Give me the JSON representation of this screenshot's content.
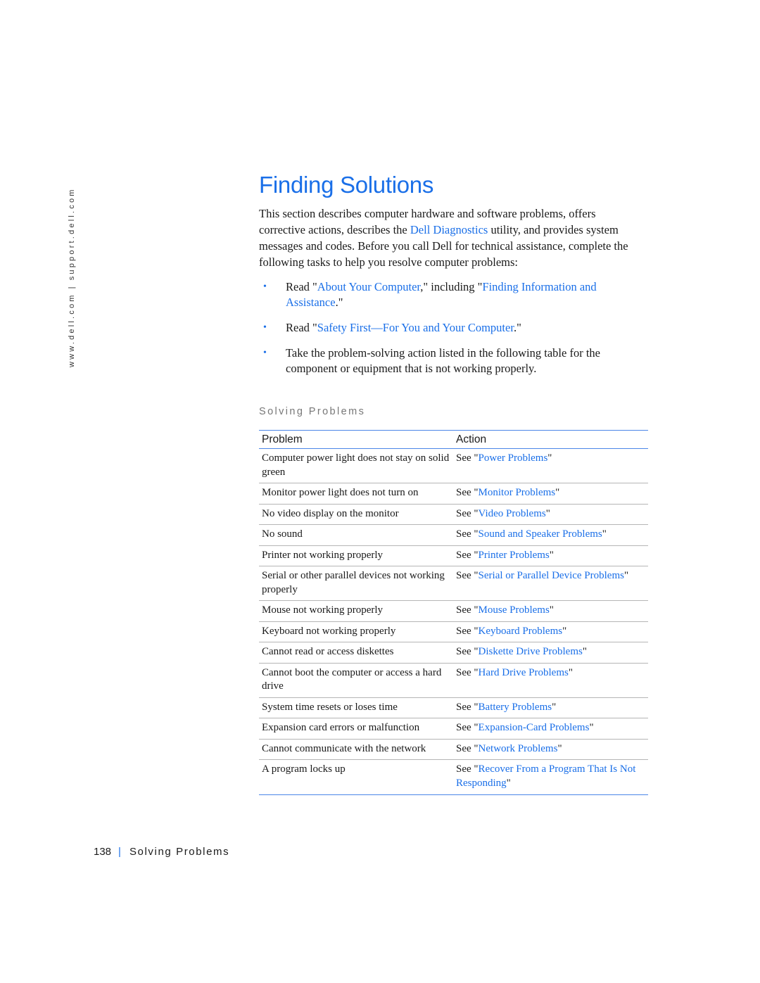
{
  "sidebar": {
    "left": "www.dell.com",
    "separator": "|",
    "right": "support.dell.com"
  },
  "title": "Finding Solutions",
  "intro": {
    "before": "This section describes computer hardware and software problems, offers corrective actions, describes the ",
    "link": "Dell Diagnostics",
    "after": " utility, and provides system messages and codes. Before you call Dell for technical assistance, complete the following tasks to help you resolve computer problems:"
  },
  "tasks": [
    {
      "bullet": "•",
      "t1": "Read \"",
      "l1": "About Your Computer",
      "t2": ",\" including \"",
      "l2": "Finding Information and Assistance",
      "t3": ".\""
    },
    {
      "bullet": "•",
      "t1": "Read \"",
      "l1": "Safety First—For You and Your Computer",
      "t2": ".\""
    },
    {
      "bullet": "•",
      "t1": "Take the problem-solving action listed in the following table for the component or equipment that is not working properly."
    }
  ],
  "table": {
    "caption": "Solving Problems",
    "headers": [
      "Problem",
      "Action"
    ],
    "see": "See \"",
    "close": "\"",
    "rows": [
      {
        "problem": "Computer power light does not stay on solid green",
        "link": "Power Problems"
      },
      {
        "problem": "Monitor power light does not turn on",
        "link": "Monitor Problems"
      },
      {
        "problem": "No video display on the monitor",
        "link": "Video Problems"
      },
      {
        "problem": "No sound",
        "link": "Sound and Speaker Problems"
      },
      {
        "problem": "Printer not working properly",
        "link": "Printer Problems"
      },
      {
        "problem": "Serial or other parallel devices not working properly",
        "link": "Serial or Parallel Device Problems"
      },
      {
        "problem": "Mouse not working properly",
        "link": "Mouse Problems"
      },
      {
        "problem": "Keyboard not working properly",
        "link": "Keyboard Problems"
      },
      {
        "problem": "Cannot read or access diskettes",
        "link": "Diskette Drive Problems"
      },
      {
        "problem": "Cannot boot the computer or access a hard drive",
        "link": "Hard Drive Problems"
      },
      {
        "problem": "System time resets or loses time",
        "link": "Battery Problems"
      },
      {
        "problem": "Expansion card errors or malfunction",
        "link": "Expansion-Card Problems"
      },
      {
        "problem": "Cannot communicate with the network",
        "link": "Network Problems"
      },
      {
        "problem": "A program locks up",
        "link": "Recover From a Program That Is Not Responding"
      }
    ]
  },
  "footer": {
    "page_number": "138",
    "separator": "|",
    "section": "Solving Problems"
  },
  "colors": {
    "accent": "#1a6fe8",
    "rule": "#4a86e8"
  }
}
